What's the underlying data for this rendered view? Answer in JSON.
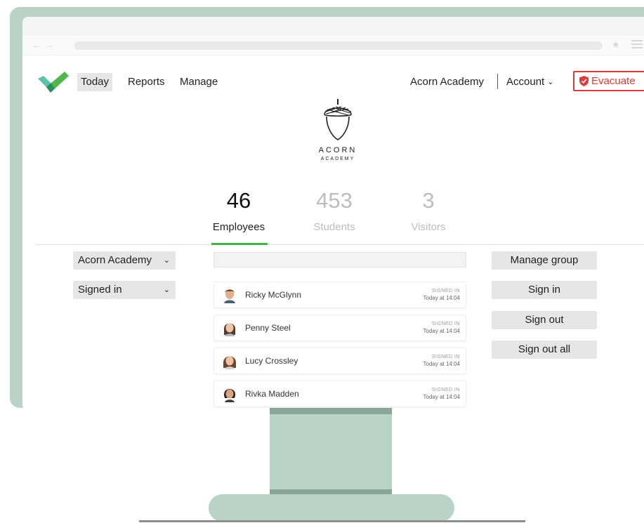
{
  "nav": {
    "today": "Today",
    "reports": "Reports",
    "manage": "Manage",
    "school": "Acorn Academy",
    "account": "Account",
    "evacuate": "Evacuate"
  },
  "brand": {
    "line1": "ACORN",
    "line2": "ACADEMY"
  },
  "stats": [
    {
      "value": "46",
      "label": "Employees",
      "active": true
    },
    {
      "value": "453",
      "label": "Students",
      "active": false
    },
    {
      "value": "3",
      "label": "Visitors",
      "active": false
    }
  ],
  "filters": {
    "school": "Acorn Academy",
    "status": "Signed in"
  },
  "search": {
    "placeholder": ""
  },
  "people": [
    {
      "name": "Ricky McGlynn",
      "status": "SIGNED IN",
      "time": "Today at 14:04"
    },
    {
      "name": "Penny Steel",
      "status": "SIGNED IN",
      "time": "Today at 14:04"
    },
    {
      "name": "Lucy Crossley",
      "status": "SIGNED IN",
      "time": "Today at 14:04"
    },
    {
      "name": "Rivka Madden",
      "status": "SIGNED IN",
      "time": "Today at 14:04"
    }
  ],
  "actions": {
    "manage_group": "Manage group",
    "sign_in": "Sign in",
    "sign_out": "Sign out",
    "sign_out_all": "Sign out all"
  },
  "colors": {
    "accent_green": "#3fb54c",
    "evacuate_red": "#e03a3a",
    "monitor": "#b9d3c8"
  }
}
